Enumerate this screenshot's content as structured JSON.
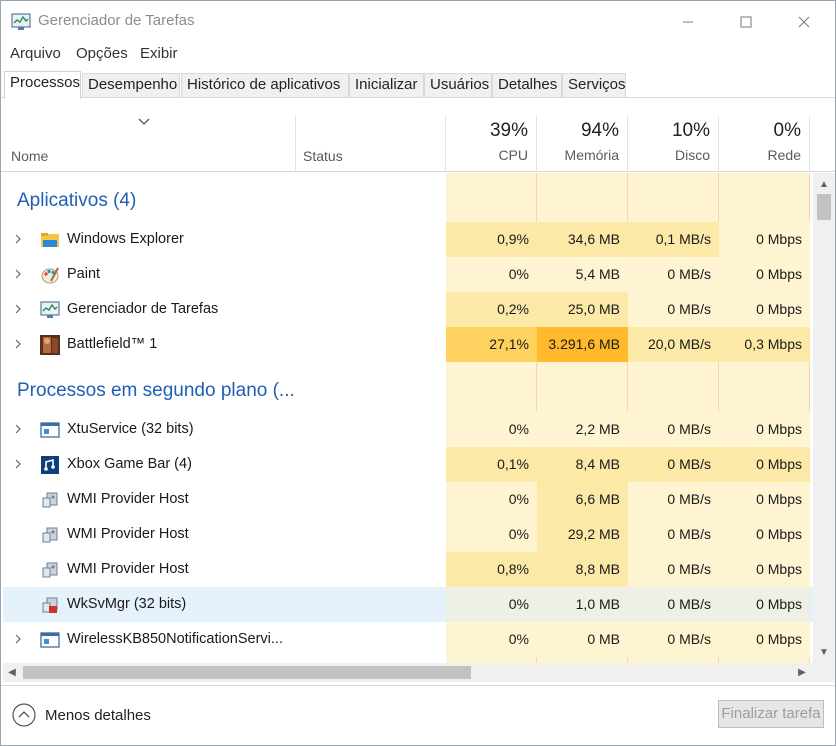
{
  "window": {
    "title": "Gerenciador de Tarefas"
  },
  "menu": [
    "Arquivo",
    "Opções",
    "Exibir"
  ],
  "tabs": [
    "Processos",
    "Desempenho",
    "Histórico de aplicativos",
    "Inicializar",
    "Usuários",
    "Detalhes",
    "Serviços"
  ],
  "columns": {
    "name": "Nome",
    "status": "Status",
    "cpu": {
      "pct": "39%",
      "label": "CPU"
    },
    "mem": {
      "pct": "94%",
      "label": "Memória"
    },
    "disk": {
      "pct": "10%",
      "label": "Disco"
    },
    "net": {
      "pct": "0%",
      "label": "Rede"
    }
  },
  "groups": {
    "apps": "Aplicativos (4)",
    "background": "Processos em segundo plano (..."
  },
  "rows": [
    {
      "name": "Windows Explorer",
      "icon": "folder-icon",
      "cpu": "0,9%",
      "mem": "34,6 MB",
      "disk": "0,1 MB/s",
      "net": "0 Mbps"
    },
    {
      "name": "Paint",
      "icon": "paint-icon",
      "cpu": "0%",
      "mem": "5,4 MB",
      "disk": "0 MB/s",
      "net": "0 Mbps"
    },
    {
      "name": "Gerenciador de Tarefas",
      "icon": "task-manager-icon",
      "cpu": "0,2%",
      "mem": "25,0 MB",
      "disk": "0 MB/s",
      "net": "0 Mbps"
    },
    {
      "name": "Battlefield™ 1",
      "icon": "battlefield-icon",
      "cpu": "27,1%",
      "mem": "3.291,6 MB",
      "disk": "20,0 MB/s",
      "net": "0,3 Mbps"
    },
    {
      "name": "XtuService (32 bits)",
      "icon": "service-window-icon",
      "cpu": "0%",
      "mem": "2,2 MB",
      "disk": "0 MB/s",
      "net": "0 Mbps"
    },
    {
      "name": "Xbox Game Bar (4)",
      "icon": "xbox-game-bar-icon",
      "cpu": "0,1%",
      "mem": "8,4 MB",
      "disk": "0 MB/s",
      "net": "0 Mbps"
    },
    {
      "name": "WMI Provider Host",
      "icon": "wmi-host-icon",
      "cpu": "0%",
      "mem": "6,6 MB",
      "disk": "0 MB/s",
      "net": "0 Mbps"
    },
    {
      "name": "WMI Provider Host",
      "icon": "wmi-host-icon",
      "cpu": "0%",
      "mem": "29,2 MB",
      "disk": "0 MB/s",
      "net": "0 Mbps"
    },
    {
      "name": "WMI Provider Host",
      "icon": "wmi-host-icon",
      "cpu": "0,8%",
      "mem": "8,8 MB",
      "disk": "0 MB/s",
      "net": "0 Mbps"
    },
    {
      "name": "WkSvMgr (32 bits)",
      "icon": "wksvmgr-icon",
      "cpu": "0%",
      "mem": "1,0 MB",
      "disk": "0 MB/s",
      "net": "0 Mbps"
    },
    {
      "name": "WirelessKB850NotificationServi...",
      "icon": "service-window-icon",
      "cpu": "0%",
      "mem": "0 MB",
      "disk": "0 MB/s",
      "net": "0 Mbps"
    }
  ],
  "footer": {
    "less_details": "Menos detalhes",
    "end_task": "Finalizar tarefa"
  },
  "colors": {
    "heat_light": "#fff4d1",
    "heat_mid": "#fce9a8",
    "heat_high": "#ffd25f",
    "heat_max": "#ffb92a",
    "group_title": "#1f5fb4",
    "selected_row": "#e5f1fb"
  }
}
